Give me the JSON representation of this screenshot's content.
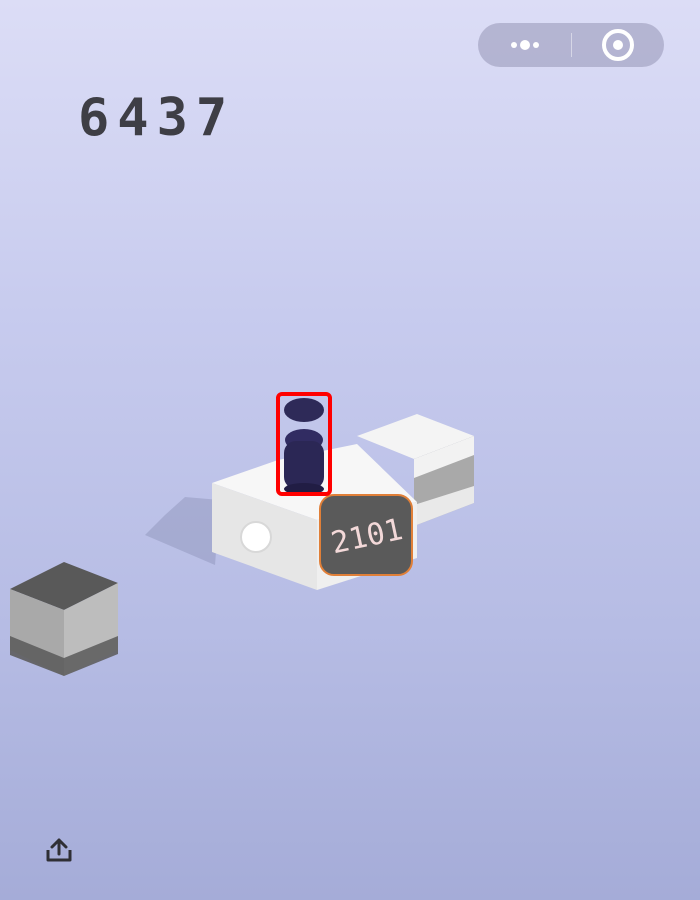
{
  "game": {
    "score": "6437",
    "platform_display": "2101"
  },
  "capsule": {
    "menu_icon": "more-dots-icon",
    "close_icon": "target-circle-icon"
  },
  "footer": {
    "share_icon": "share-upload-icon"
  },
  "colors": {
    "score": "#3e3e45",
    "highlight": "#ff0000",
    "player": "#2f2a5a",
    "display_bg": "#5a5a5a",
    "display_text": "#f3d9d9"
  }
}
